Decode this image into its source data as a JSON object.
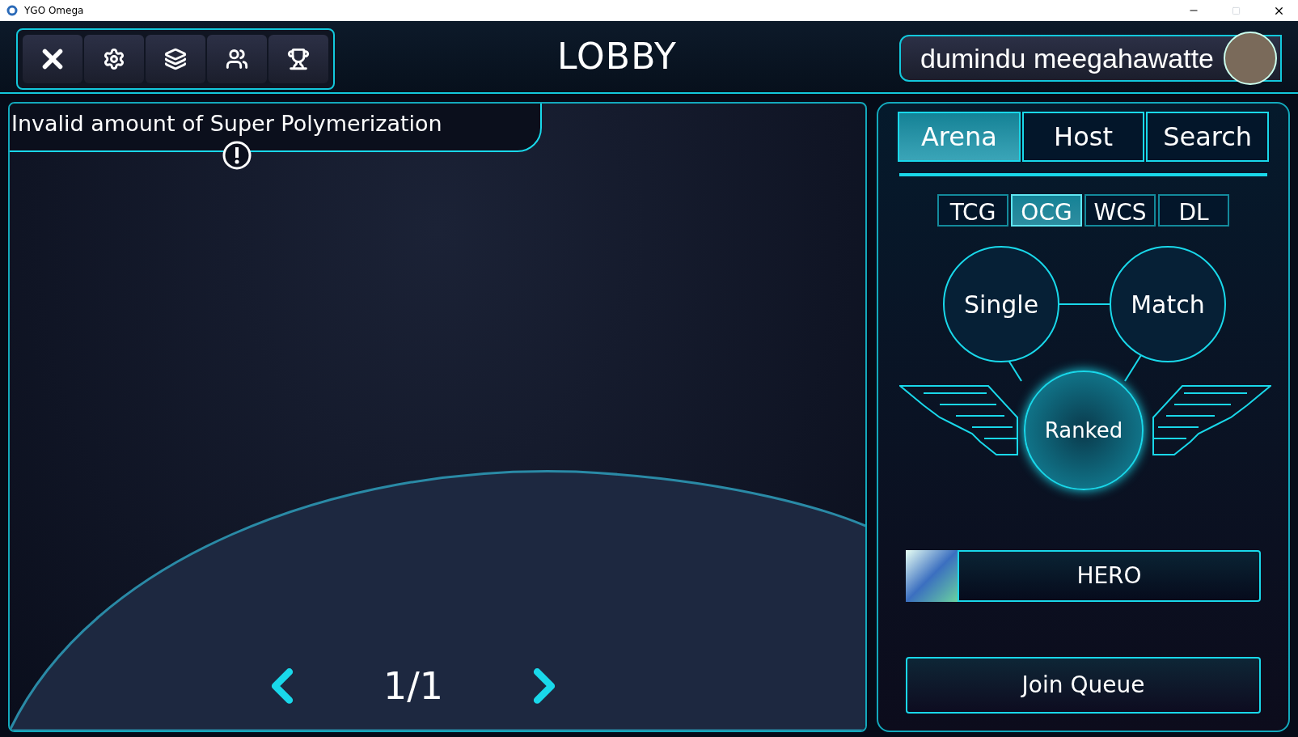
{
  "window": {
    "title": "YGO Omega"
  },
  "header": {
    "title": "LOBBY",
    "username": "dumindu meegahawatte"
  },
  "notification": {
    "text": "Invalid amount of Super Polymerization"
  },
  "pager": {
    "text": "1/1"
  },
  "tabs": [
    {
      "label": "Arena",
      "selected": true
    },
    {
      "label": "Host",
      "selected": false
    },
    {
      "label": "Search",
      "selected": false
    }
  ],
  "formats": [
    {
      "label": "TCG",
      "selected": false
    },
    {
      "label": "OCG",
      "selected": true
    },
    {
      "label": "WCS",
      "selected": false
    },
    {
      "label": "DL",
      "selected": false
    }
  ],
  "modes": [
    {
      "label": "Single",
      "selected": false
    },
    {
      "label": "Match",
      "selected": false
    },
    {
      "label": "Ranked",
      "selected": true
    }
  ],
  "deck": {
    "name": "HERO"
  },
  "join_button": {
    "label": "Join Queue"
  }
}
